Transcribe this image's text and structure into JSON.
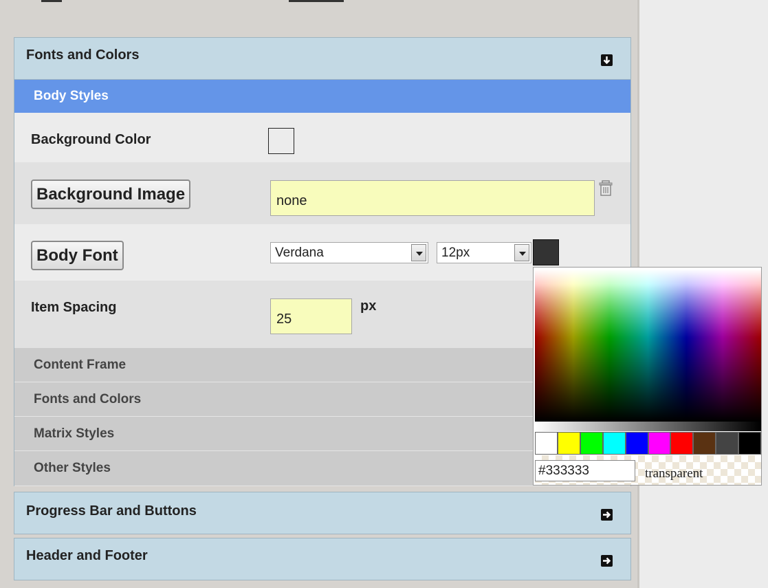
{
  "accordion": {
    "fonts_colors_title": "Fonts and Colors",
    "progress_title": "Progress Bar and Buttons",
    "header_footer_title": "Header and Footer"
  },
  "body_styles": {
    "title": "Body Styles",
    "background_color_label": "Background Color",
    "background_image_button": "Background Image",
    "background_image_value": "none",
    "body_font_button": "Body Font",
    "font_family_value": "Verdana",
    "font_size_value": "12px",
    "font_color": "#333333",
    "item_spacing_label": "Item Spacing",
    "item_spacing_value": "25",
    "item_spacing_unit": "px"
  },
  "nav_items": [
    {
      "label": "Content Frame"
    },
    {
      "label": "Fonts and Colors"
    },
    {
      "label": "Matrix Styles"
    },
    {
      "label": "Other Styles"
    }
  ],
  "color_picker": {
    "hex_value": "#333333",
    "transparent_label": "transparent",
    "swatches": [
      "#ffffff",
      "#ffff00",
      "#00ff00",
      "#00ffff",
      "#0000ff",
      "#ff00ff",
      "#ff0000",
      "#5a3212",
      "#444444",
      "#000000"
    ]
  }
}
